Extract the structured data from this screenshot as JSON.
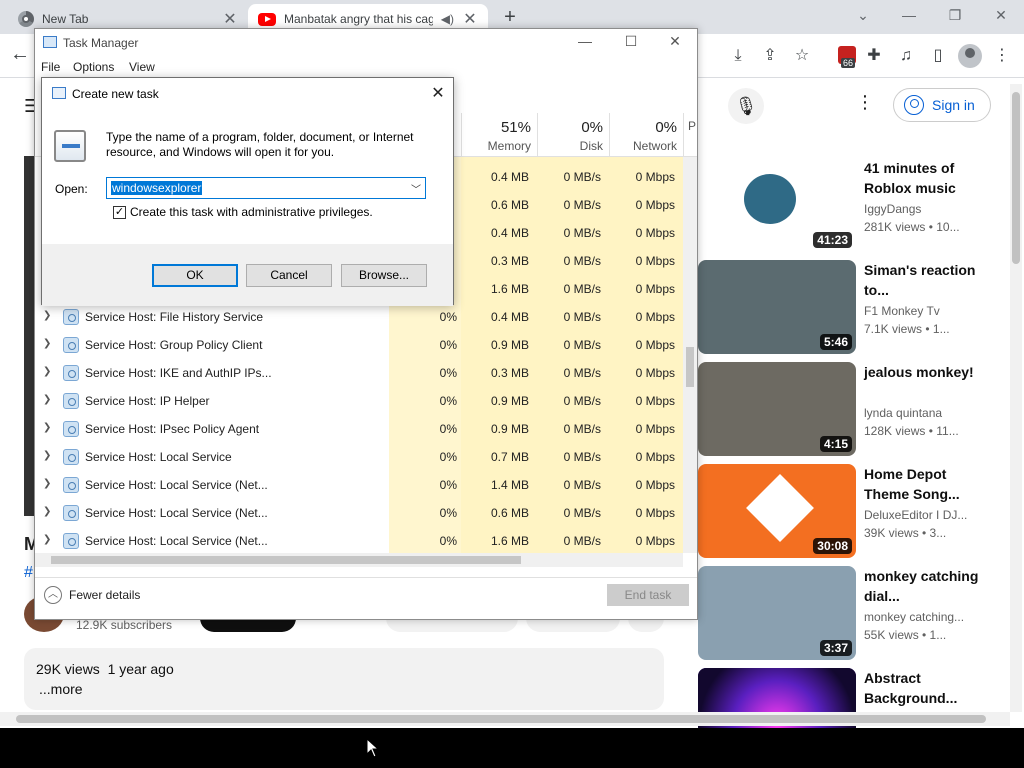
{
  "browser": {
    "tabs": [
      {
        "title": "New Tab"
      },
      {
        "title": "Manbatak angry that his cage"
      }
    ],
    "new_tab_symbol": "+",
    "extension_badge_count": "66",
    "icons": [
      "back-arrow-icon",
      "download-icon",
      "share-icon",
      "star-icon",
      "puzzle-icon",
      "media-icon",
      "sidepanel-icon",
      "profile-icon",
      "menu-dots-icon"
    ]
  },
  "youtube": {
    "signin_label": "Sign in",
    "video_title_fragment": "M",
    "hashtag_fragment": "#",
    "subscribers": "12.9K subscribers",
    "description_meta": "29K views  1 year ago",
    "description_more": "...more",
    "recommendations": [
      {
        "title": "41 minutes of Roblox music",
        "channel": "IggyDangs",
        "views": "281K views  •  10...",
        "duration": "41:23",
        "thumb_color": "#ffffff"
      },
      {
        "title": "Siman's reaction to...",
        "channel": "F1 Monkey Tv",
        "views": "7.1K views  •  1...",
        "duration": "5:46",
        "thumb_color": "#5b6b70"
      },
      {
        "title": "jealous monkey!",
        "channel": "lynda quintana",
        "views": "128K views  •  11...",
        "duration": "4:15",
        "thumb_color": "#6d6a62"
      },
      {
        "title": "Home Depot Theme Song...",
        "channel": "DeluxeEditor I DJ...",
        "views": "39K views  •  3...",
        "duration": "30:08",
        "thumb_color": "#f36f21"
      },
      {
        "title": "monkey catching dial...",
        "channel": "monkey catching...",
        "views": "55K views  •  1...",
        "duration": "3:37",
        "thumb_color": "#8aa0b0"
      },
      {
        "title": "Abstract Background...",
        "channel": "",
        "views": "",
        "duration": "",
        "thumb_color": "#5a1fc0"
      }
    ]
  },
  "taskmgr": {
    "title": "Task Manager",
    "menu": [
      "File",
      "Options",
      "View"
    ],
    "columns": [
      {
        "pct": "51%",
        "label": "Memory"
      },
      {
        "pct": "0%",
        "label": "Disk"
      },
      {
        "pct": "0%",
        "label": "Network"
      },
      {
        "pct": "",
        "label": "P"
      }
    ],
    "hidden_rows": [
      {
        "memory": "0.4 MB",
        "disk": "0 MB/s",
        "network": "0 Mbps"
      },
      {
        "memory": "0.6 MB",
        "disk": "0 MB/s",
        "network": "0 Mbps"
      },
      {
        "memory": "0.4 MB",
        "disk": "0 MB/s",
        "network": "0 Mbps"
      },
      {
        "memory": "0.3 MB",
        "disk": "0 MB/s",
        "network": "0 Mbps"
      },
      {
        "memory": "1.6 MB",
        "disk": "0 MB/s",
        "network": "0 Mbps"
      }
    ],
    "rows": [
      {
        "name": "Service Host: File History Service",
        "cpu": "0%",
        "memory": "0.4 MB",
        "disk": "0 MB/s",
        "network": "0 Mbps"
      },
      {
        "name": "Service Host: Group Policy Client",
        "cpu": "0%",
        "memory": "0.9 MB",
        "disk": "0 MB/s",
        "network": "0 Mbps"
      },
      {
        "name": "Service Host: IKE and AuthIP IPs...",
        "cpu": "0%",
        "memory": "0.3 MB",
        "disk": "0 MB/s",
        "network": "0 Mbps"
      },
      {
        "name": "Service Host: IP Helper",
        "cpu": "0%",
        "memory": "0.9 MB",
        "disk": "0 MB/s",
        "network": "0 Mbps"
      },
      {
        "name": "Service Host: IPsec Policy Agent",
        "cpu": "0%",
        "memory": "0.9 MB",
        "disk": "0 MB/s",
        "network": "0 Mbps"
      },
      {
        "name": "Service Host: Local Service",
        "cpu": "0%",
        "memory": "0.7 MB",
        "disk": "0 MB/s",
        "network": "0 Mbps"
      },
      {
        "name": "Service Host: Local Service (Net...",
        "cpu": "0%",
        "memory": "1.4 MB",
        "disk": "0 MB/s",
        "network": "0 Mbps"
      },
      {
        "name": "Service Host: Local Service (Net...",
        "cpu": "0%",
        "memory": "0.6 MB",
        "disk": "0 MB/s",
        "network": "0 Mbps"
      },
      {
        "name": "Service Host: Local Service (Net...",
        "cpu": "0%",
        "memory": "1.6 MB",
        "disk": "0 MB/s",
        "network": "0 Mbps"
      }
    ],
    "fewer_details": "Fewer details",
    "end_task": "End task"
  },
  "dialog": {
    "title": "Create new task",
    "description": "Type the name of a program, folder, document, or Internet resource, and Windows will open it for you.",
    "open_label": "Open:",
    "open_value": "windowsexplorer",
    "admin_checked": true,
    "admin_label": "Create this task with administrative privileges.",
    "ok_label": "OK",
    "cancel_label": "Cancel",
    "browse_label": "Browse..."
  }
}
